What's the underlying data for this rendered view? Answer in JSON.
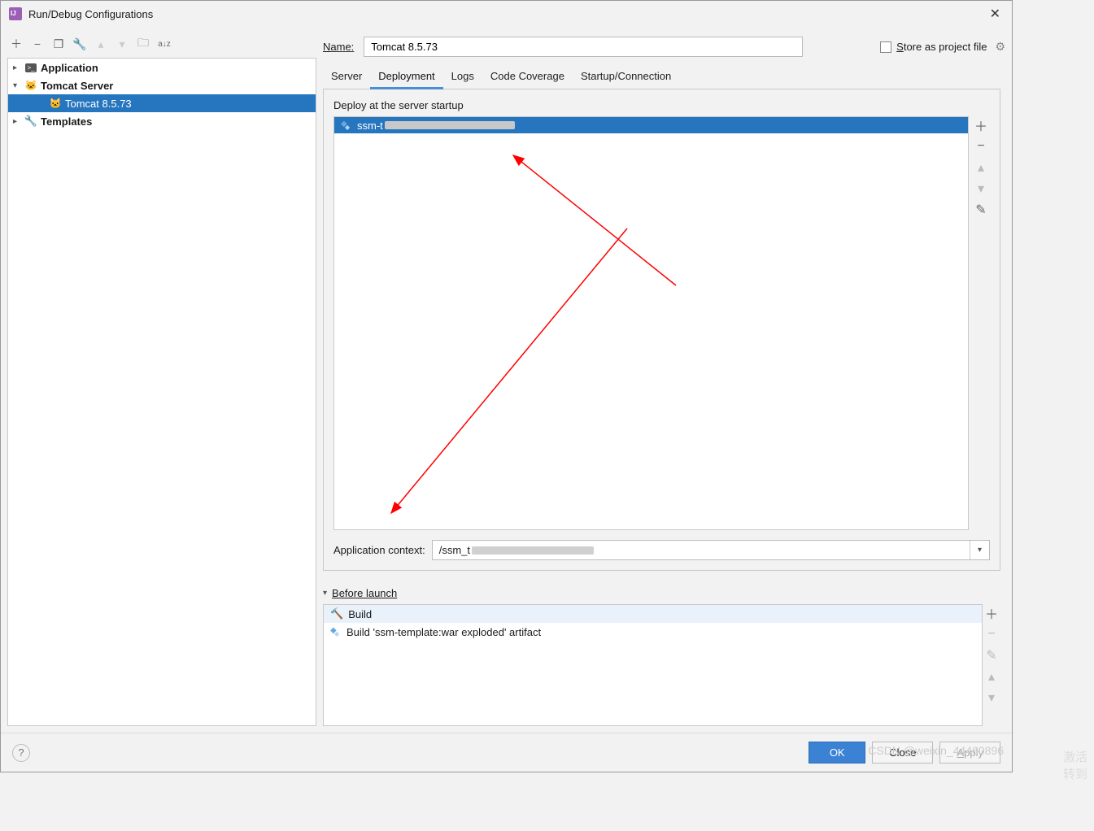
{
  "window": {
    "title": "Run/Debug Configurations"
  },
  "toolbar": {
    "add": "＋",
    "remove": "−",
    "copy_icon": "copy",
    "wrench": "wrench",
    "up": "▴",
    "down": "▾",
    "folder": "folder",
    "sort": "a↓z"
  },
  "tree": {
    "nodes": [
      {
        "expand": "▸",
        "label": "Application",
        "bold": true,
        "indent": 0,
        "icon": "terminal"
      },
      {
        "expand": "▾",
        "label": "Tomcat Server",
        "bold": true,
        "indent": 0,
        "icon": "tomcat"
      },
      {
        "expand": "",
        "label": "Tomcat 8.5.73",
        "bold": false,
        "indent": 1,
        "icon": "tomcat",
        "selected": true
      },
      {
        "expand": "▸",
        "label": "Templates",
        "bold": true,
        "indent": 0,
        "icon": "wrench"
      }
    ]
  },
  "name": {
    "label_html": "Name:",
    "value": "Tomcat 8.5.73"
  },
  "store": {
    "label": "Store as project file"
  },
  "tabs": [
    {
      "label": "Server",
      "active": false
    },
    {
      "label": "Deployment",
      "active": true
    },
    {
      "label": "Logs",
      "active": false
    },
    {
      "label": "Code Coverage",
      "active": false
    },
    {
      "label": "Startup/Connection",
      "active": false
    }
  ],
  "deploy": {
    "header": "Deploy at the server startup",
    "items": [
      {
        "prefix": "ssm-t",
        "redacted": true
      }
    ],
    "context_label": "Application context:",
    "context_prefix": "/ssm_t"
  },
  "before_launch": {
    "title": "Before launch",
    "items": [
      {
        "icon": "hammer",
        "label": "Build",
        "selected": true
      },
      {
        "icon": "artifact",
        "label": "Build 'ssm-template:war exploded' artifact",
        "selected": false
      }
    ]
  },
  "footer": {
    "ok": "OK",
    "cancel": "Close",
    "apply": "Apply"
  },
  "watermark": "CSDN @weixin_44460896",
  "watermark2": "激活\n转到"
}
